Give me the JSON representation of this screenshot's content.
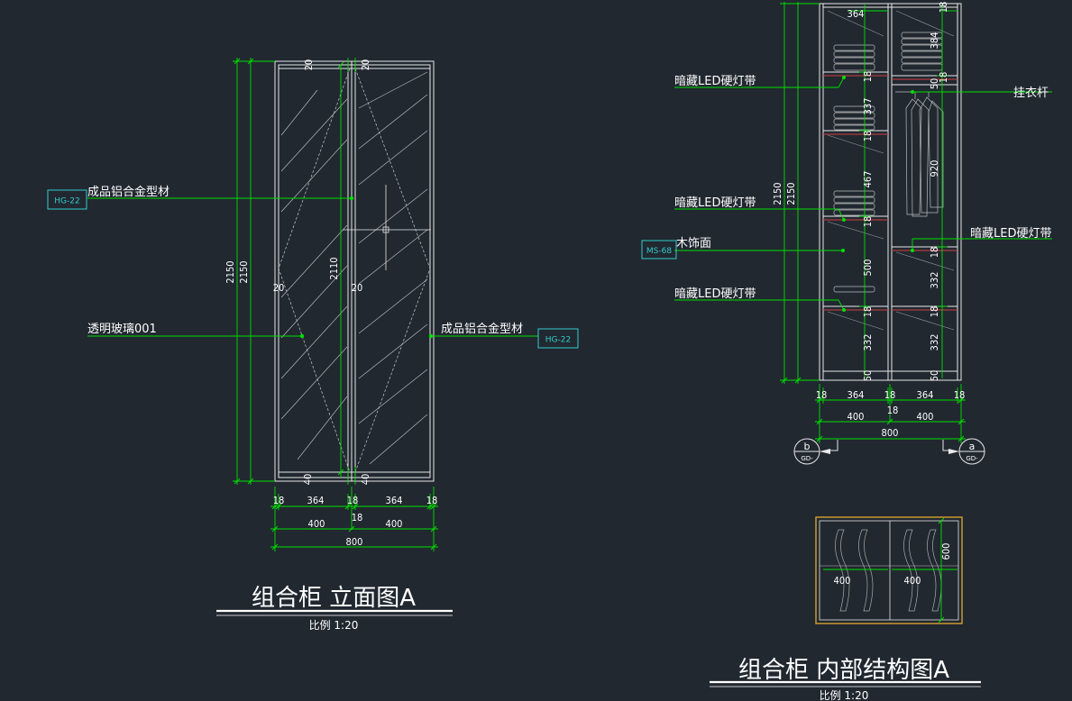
{
  "views": {
    "elevation": {
      "title": "组合柜 立面图A",
      "scale": "比例 1:20",
      "labels": {
        "top_profile": "成品铝合金型材",
        "right_profile": "成品铝合金型材",
        "glass": "透明玻璃001"
      },
      "tags": {
        "left": "HG-22",
        "right": "HG-22"
      },
      "dims": {
        "overall_height": "2150",
        "overall_height2": "2150",
        "door_height": "2110",
        "top_left": "20",
        "top_right": "20",
        "mid_left": "20",
        "mid_right": "20",
        "bottom_left": "40",
        "bottom_right": "40",
        "w_side_l": "18",
        "w_panel_l": "364",
        "w_mid": "18",
        "w_panel_r": "364",
        "w_side_r": "18",
        "mid_18": "18",
        "half_l": "400",
        "half_r": "400",
        "total": "800"
      }
    },
    "internal": {
      "title": "组合柜 内部结构图A",
      "scale": "比例 1:20",
      "labels": {
        "led1": "暗藏LED硬灯带",
        "led2": "暗藏LED硬灯带",
        "led3": "暗藏LED硬灯带",
        "led_right": "暗藏LED硬灯带",
        "wood": "木饰面",
        "rail": "挂衣杆"
      },
      "tags": {
        "wood": "MS-68"
      },
      "dims": {
        "overall_height": "2150",
        "overall_height2": "2150",
        "top_w": "364",
        "top_18": "18",
        "l_18a": "18",
        "l_337": "337",
        "l_18b": "18",
        "l_467": "467",
        "l_18c": "18",
        "l_500": "500",
        "l_18d": "18",
        "l_332": "332",
        "l_50": "50",
        "r_384": "384",
        "r_18": "18",
        "r_50": "50",
        "r_920": "920",
        "r_18b": "18",
        "r_332a": "332",
        "r_18c": "18",
        "r_332b": "332",
        "r_50b": "50",
        "w_side_l": "18",
        "w_panel_l": "364",
        "w_mid": "18",
        "w_panel_r": "364",
        "w_side_r": "18",
        "mid_18": "18",
        "half_l": "400",
        "half_r": "400",
        "total": "800"
      },
      "sections": {
        "left": "b",
        "left_ref": "GD-",
        "right": "a",
        "right_ref": "GD-"
      }
    },
    "plan": {
      "dims": {
        "depth": "600",
        "w_l": "400",
        "w_r": "400"
      }
    }
  },
  "colors": {
    "background": "#212830",
    "dimension": "#00e000",
    "outline": "#e8e8e8",
    "tag": "#33cccc",
    "accent": "#d8a030",
    "shelf_red": "#d04040"
  }
}
